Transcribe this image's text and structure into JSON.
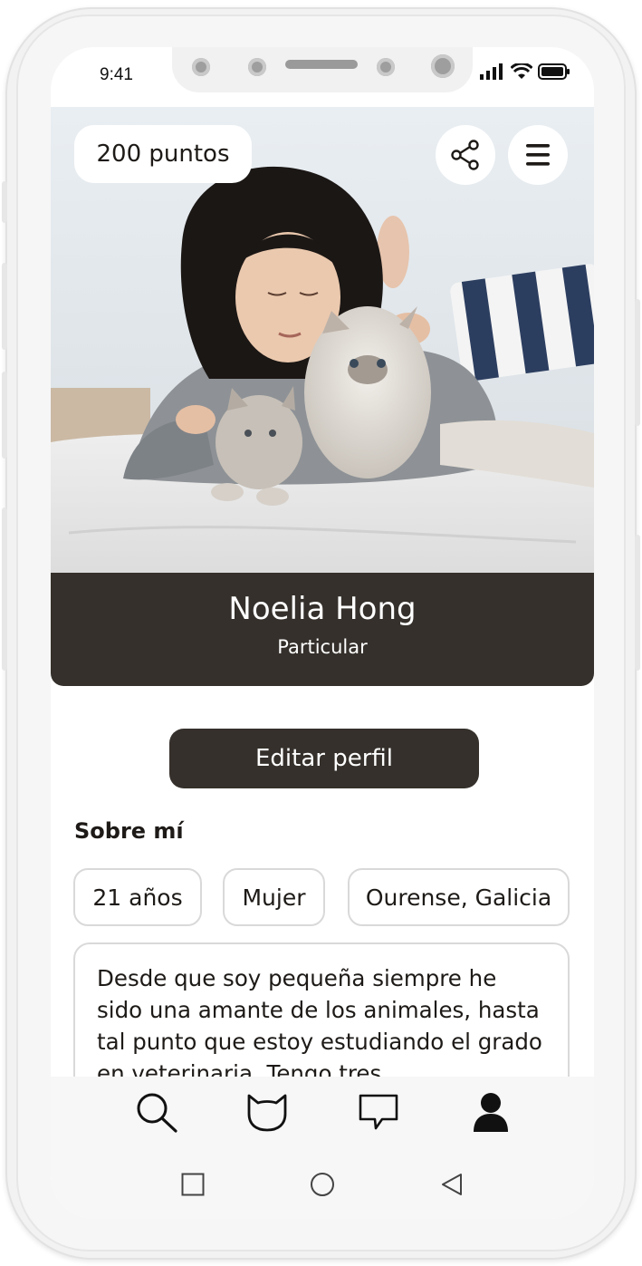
{
  "status_bar": {
    "time": "9:41",
    "icons": [
      "signal-icon",
      "wifi-icon",
      "battery-icon"
    ]
  },
  "header": {
    "points_label": "200 puntos",
    "share_icon": "share-icon",
    "menu_icon": "hamburger-menu-icon"
  },
  "profile": {
    "photo": "profile-photo-with-cats",
    "name": "Noelia Hong",
    "type": "Particular",
    "edit_label": "Editar perfil"
  },
  "about": {
    "title": "Sobre mí",
    "chips": [
      "21 años",
      "Mujer",
      "Ourense, Galicia"
    ],
    "bio": "Desde que soy pequeña siempre he sido una amante de los animales, hasta tal punto que estoy estudiando el grado en veterinaria. Tengo tres"
  },
  "bottom_nav": {
    "items": [
      "search-icon",
      "cat-icon",
      "chat-icon",
      "profile-icon"
    ],
    "active": "profile-icon"
  },
  "system_nav": [
    "square-icon",
    "circle-icon",
    "back-triangle-icon"
  ],
  "colors": {
    "dark": "#35302b",
    "chip_border": "#d9d9d9",
    "nav_bg": "#f7f7f7"
  }
}
